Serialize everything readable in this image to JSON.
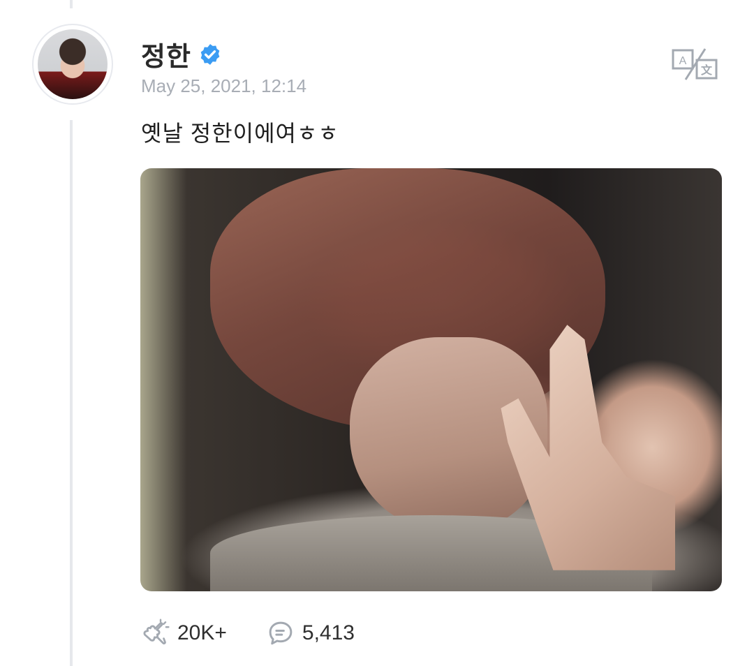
{
  "post": {
    "author": "정한",
    "verified_icon": "verified-badge-icon",
    "timestamp": "May 25, 2021, 12:14",
    "text": "옛날 정한이에여ㅎㅎ",
    "translate_icon": "translate-icon"
  },
  "actions": {
    "likes": {
      "icon": "cheer-icon",
      "count": "20K+"
    },
    "comments": {
      "icon": "comment-icon",
      "count": "5,413"
    }
  },
  "colors": {
    "verified": "#3b9cf3",
    "timestamp": "#a8adb5",
    "icon_gray": "#a3a9b1",
    "thread_line": "#e6e8ec"
  }
}
